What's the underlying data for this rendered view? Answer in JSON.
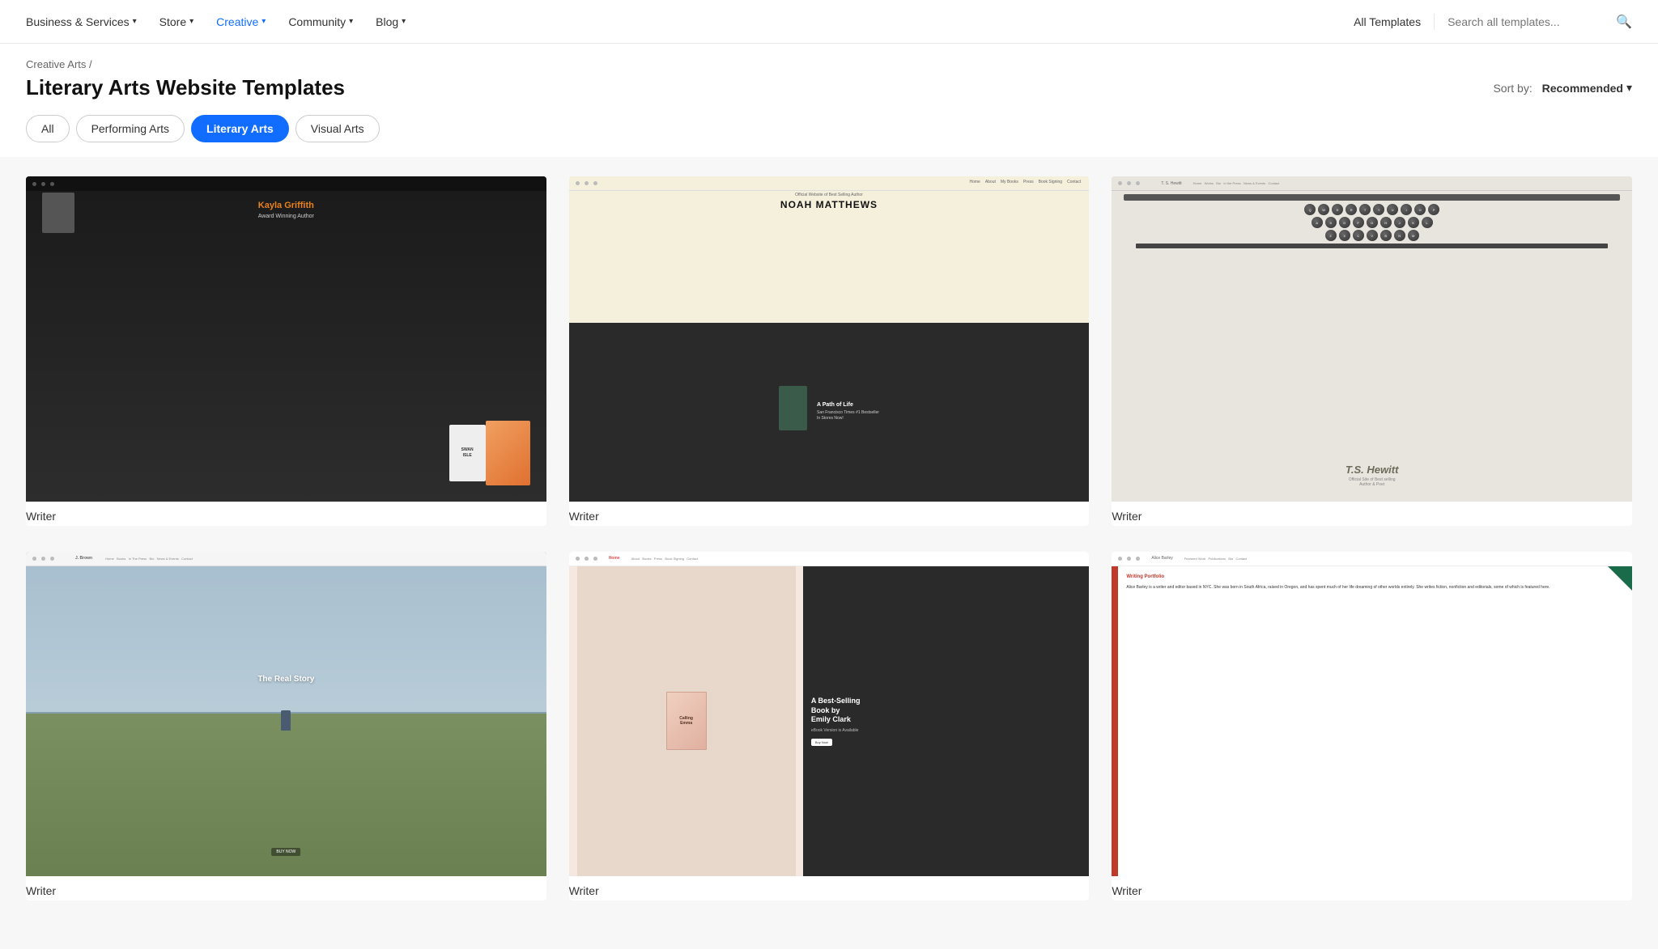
{
  "nav": {
    "items": [
      {
        "label": "Business & Services",
        "hasDropdown": true,
        "active": false
      },
      {
        "label": "Store",
        "hasDropdown": true,
        "active": false
      },
      {
        "label": "Creative",
        "hasDropdown": true,
        "active": true
      },
      {
        "label": "Community",
        "hasDropdown": true,
        "active": false
      },
      {
        "label": "Blog",
        "hasDropdown": true,
        "active": false
      }
    ],
    "all_templates_label": "All Templates",
    "search_placeholder": "Search all templates...",
    "search_icon": "🔍"
  },
  "breadcrumb": {
    "parent": "Creative Arts",
    "separator": "/"
  },
  "header": {
    "page_title": "Literary Arts Website Templates",
    "sort_label": "Sort by:",
    "sort_value": "Recommended",
    "sort_chevron": "▾"
  },
  "filters": [
    {
      "label": "All",
      "active": false
    },
    {
      "label": "Performing Arts",
      "active": false
    },
    {
      "label": "Literary Arts",
      "active": true
    },
    {
      "label": "Visual Arts",
      "active": false
    }
  ],
  "templates": [
    {
      "id": 1,
      "category": "Writer",
      "preview_type": "dark-author",
      "author_name": "Kayla Griffith",
      "subtitle": "Award Winning Author",
      "book_title": "SWAN ISLE"
    },
    {
      "id": 2,
      "category": "Writer",
      "preview_type": "cream-author",
      "author_name": "NOAH MATTHEWS",
      "book_title": "A Path of Life",
      "book_subtitle": "San Francisco Times #1 Bestseller In Stores Now!"
    },
    {
      "id": 3,
      "category": "Writer",
      "preview_type": "typewriter",
      "author_name": "T.S. Hewitt",
      "subtitle": "Official Site of Best selling Author & Poet"
    },
    {
      "id": 4,
      "category": "Writer",
      "preview_type": "field-story",
      "author_name": "J. Brown",
      "book_title": "The Real Story"
    },
    {
      "id": 5,
      "category": "Writer",
      "preview_type": "pink-book",
      "book_title": "Calling Emma",
      "headline": "A Best-Selling Book by Emily Clark",
      "sub": "eBook Version is Available"
    },
    {
      "id": 6,
      "category": "Writer",
      "preview_type": "portfolio",
      "portfolio_label": "Writing Portfolio",
      "bio": "Alice Barley is a writer and editor based in NYC. She was born in South Africa, raised in Oregon, and has spent much of her life dreaming of other worlds entirely. She writes fiction, nonfiction and editorials, some of which is featured here."
    }
  ],
  "colors": {
    "accent": "#116dff",
    "active_filter_bg": "#116dff",
    "active_filter_text": "#ffffff",
    "card_label_color": "#333333",
    "breadcrumb_color": "#666666"
  }
}
